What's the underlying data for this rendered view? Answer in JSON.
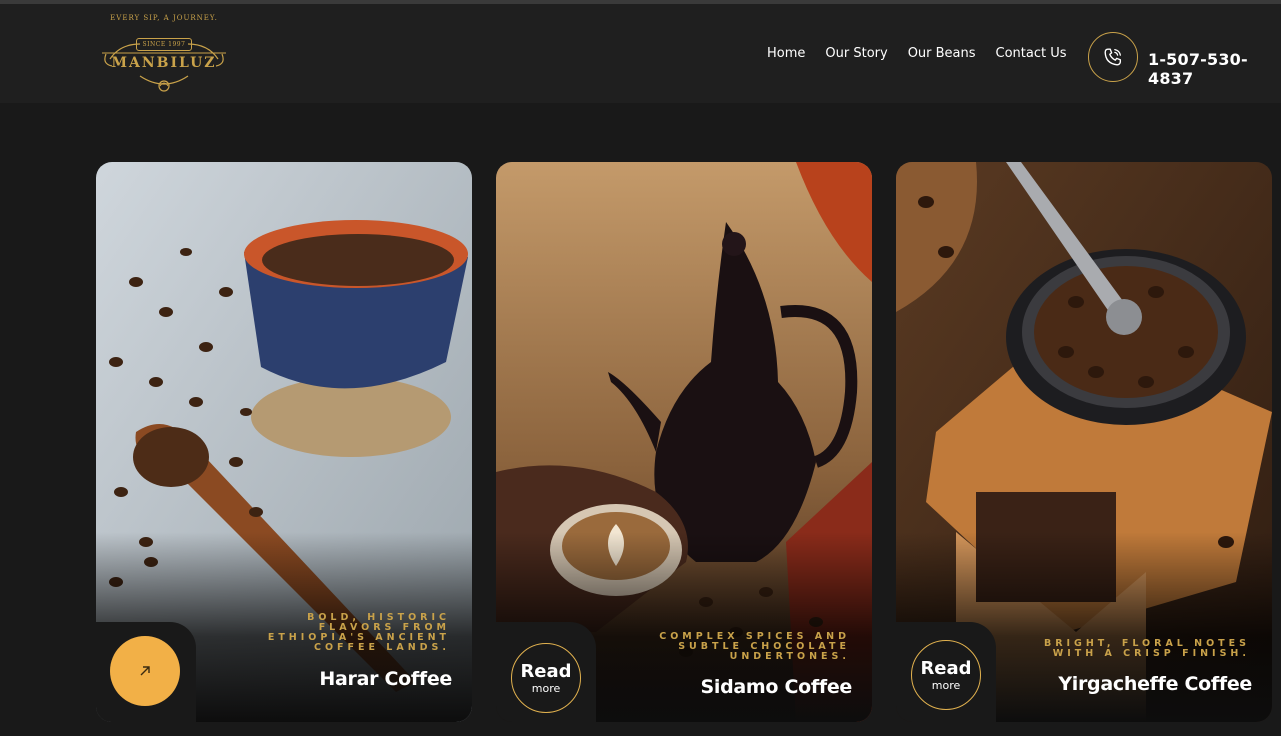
{
  "brand": {
    "tagline": "EVERY SIP, A JOURNEY.",
    "since": "SINCE 1997",
    "name": "MANBILUZ"
  },
  "nav": {
    "items": [
      "Home",
      "Our Story",
      "Our Beans",
      "Contact Us"
    ]
  },
  "contact": {
    "phone_icon": "phone-icon",
    "phone": "1-507-530-4837"
  },
  "cards": [
    {
      "tagline": "Bold, historic flavors from Ethiopia's ancient coffee lands.",
      "title": "Harar Coffee",
      "button_icon": "arrow-up-right-icon"
    },
    {
      "tagline": "Complex spices and subtle chocolate undertones.",
      "title": "Sidamo Coffee",
      "read_label": "Read",
      "more_label": "more"
    },
    {
      "tagline": "Bright, floral notes with a crisp finish.",
      "title": "Yirgacheffe Coffee",
      "read_label": "Read",
      "more_label": "more"
    }
  ],
  "colors": {
    "accent": "#c9a24a",
    "button": "#f2b047",
    "background": "#191919",
    "header": "#1f1f1f"
  }
}
